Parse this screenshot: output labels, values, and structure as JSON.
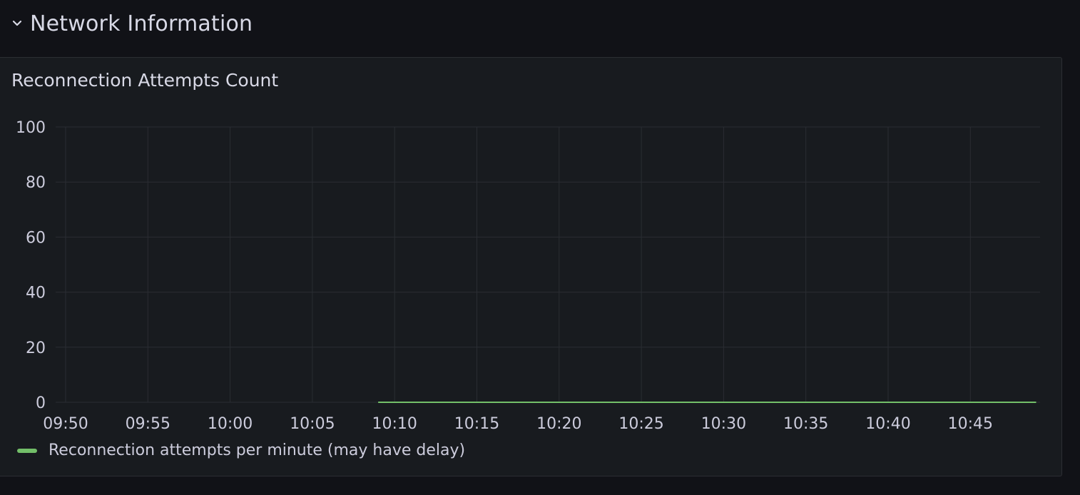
{
  "row": {
    "title": "Network Information",
    "collapse_icon": "chevron-down-icon"
  },
  "panel": {
    "title": "Reconnection Attempts Count"
  },
  "colors": {
    "background": "#111217",
    "panel_bg": "#181b1f",
    "grid": "#2a2d33",
    "series": "#73bf69",
    "text": "#ccccdc"
  },
  "chart_data": {
    "type": "line",
    "xlabel": "",
    "ylabel": "",
    "ylim": [
      0,
      100
    ],
    "yticks": [
      0,
      20,
      40,
      60,
      80,
      100
    ],
    "xticks": [
      "09:50",
      "09:55",
      "10:00",
      "10:05",
      "10:10",
      "10:15",
      "10:20",
      "10:25",
      "10:30",
      "10:35",
      "10:40",
      "10:45"
    ],
    "xlim": [
      "09:50",
      "10:49"
    ],
    "grid": true,
    "legend": "bottom-left",
    "series": [
      {
        "name": "Reconnection attempts per minute (may have delay)",
        "color": "#73bf69",
        "x": [
          "10:09",
          "10:49"
        ],
        "values": [
          0,
          0
        ]
      }
    ]
  }
}
